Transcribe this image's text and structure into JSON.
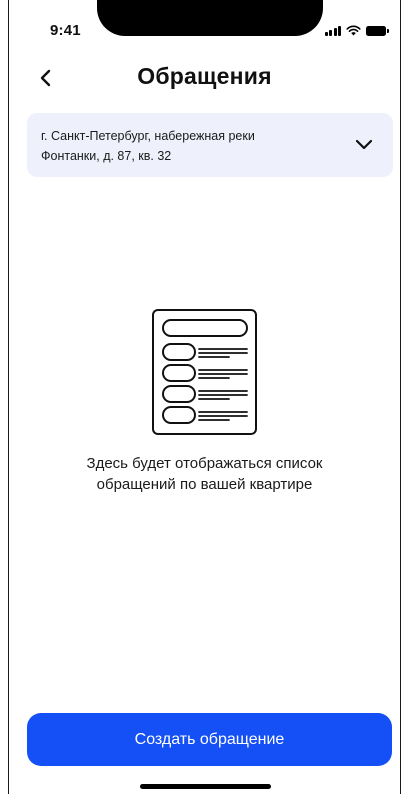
{
  "status_bar": {
    "time": "9:41"
  },
  "header": {
    "title": "Обращения"
  },
  "address_selector": {
    "line1": "г. Санкт-Петербург, набережная реки",
    "line2": "Фонтанки, д. 87, кв. 32"
  },
  "empty_state": {
    "line1": "Здесь будет отображаться список",
    "line2": "обращений по вашей квартире"
  },
  "actions": {
    "create_label": "Создать обращение"
  },
  "colors": {
    "accent": "#1450f5",
    "selector_bg": "#eef1fb"
  }
}
